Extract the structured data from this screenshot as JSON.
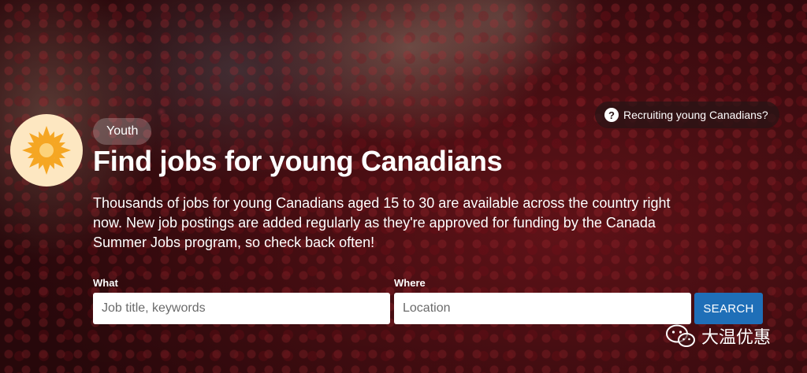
{
  "recruit_link": {
    "label": "Recruiting young Canadians?",
    "icon": "question-circle-icon"
  },
  "category": {
    "label": "Youth",
    "icon": "sun-icon"
  },
  "hero": {
    "title": "Find jobs for young Canadians",
    "description": "Thousands of jobs for young Canadians aged 15 to 30 are available across the country right now. New job postings are added regularly as they're approved for funding by the Canada Summer Jobs program, so check back often!"
  },
  "search": {
    "what_label": "What",
    "what_placeholder": "Job title, keywords",
    "where_label": "Where",
    "where_placeholder": "Location",
    "button_label": "SEARCH"
  },
  "watermark": {
    "text": "大温优惠",
    "icon": "wechat-icon"
  },
  "colors": {
    "accent_button": "#1f6fb8",
    "logo_bg": "#fde7c1",
    "sun": "#f5a623"
  }
}
